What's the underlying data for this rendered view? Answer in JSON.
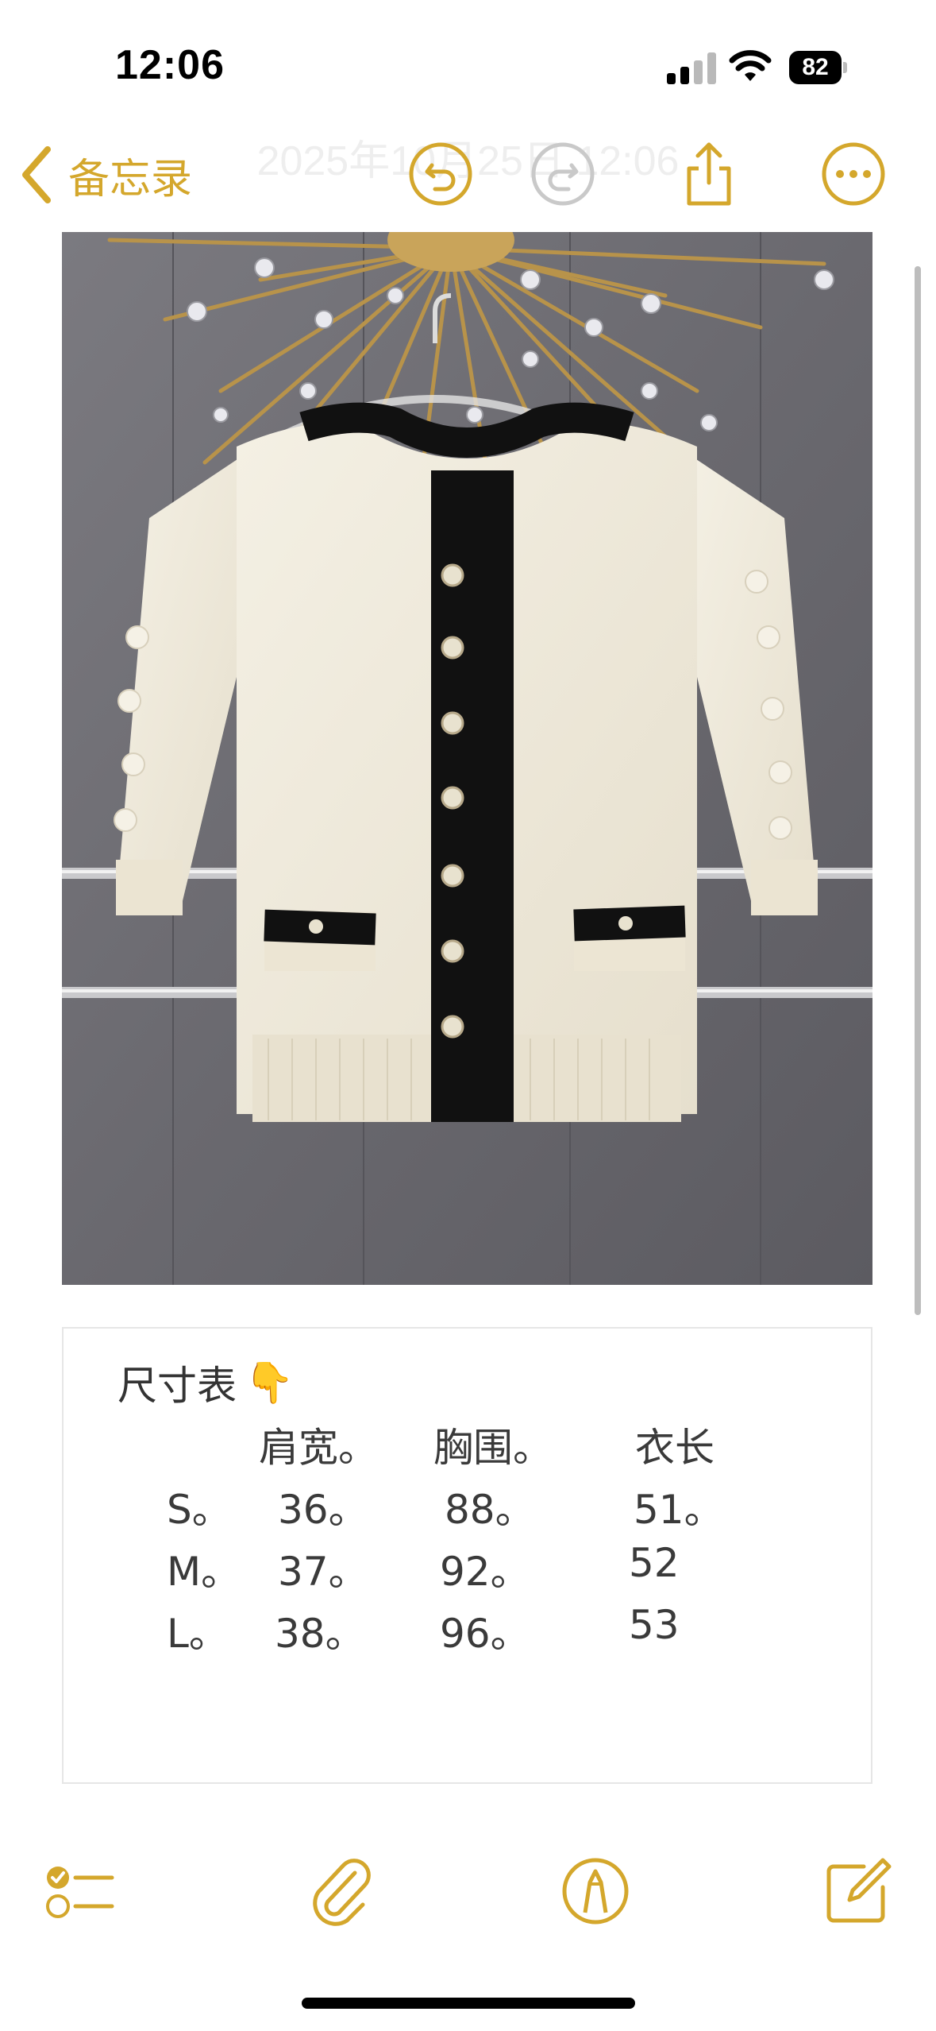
{
  "status_bar": {
    "time": "12:06",
    "battery": "82"
  },
  "nav": {
    "back_label": "备忘录",
    "ghost_date": "2025年10月25日 12:06",
    "accent_color": "#d4a72c",
    "icons": [
      "chevron-left-icon",
      "undo-icon",
      "redo-icon",
      "share-icon",
      "more-icon"
    ]
  },
  "note": {
    "size_table": {
      "title": "尺寸表",
      "emoji": "👇",
      "headers": [
        "肩宽。",
        "胸围。",
        "衣长"
      ],
      "rows": [
        {
          "size": "S。",
          "shoulder": "36。",
          "chest": "88。",
          "length": "51。"
        },
        {
          "size": "M。",
          "shoulder": "37。",
          "chest": "92。",
          "length": "52"
        },
        {
          "size": "L。",
          "shoulder": "38。",
          "chest": "96。",
          "length": "53"
        }
      ]
    }
  },
  "toolbar": {
    "icons": [
      "checklist-icon",
      "paperclip-icon",
      "markup-pen-icon",
      "compose-icon"
    ]
  }
}
